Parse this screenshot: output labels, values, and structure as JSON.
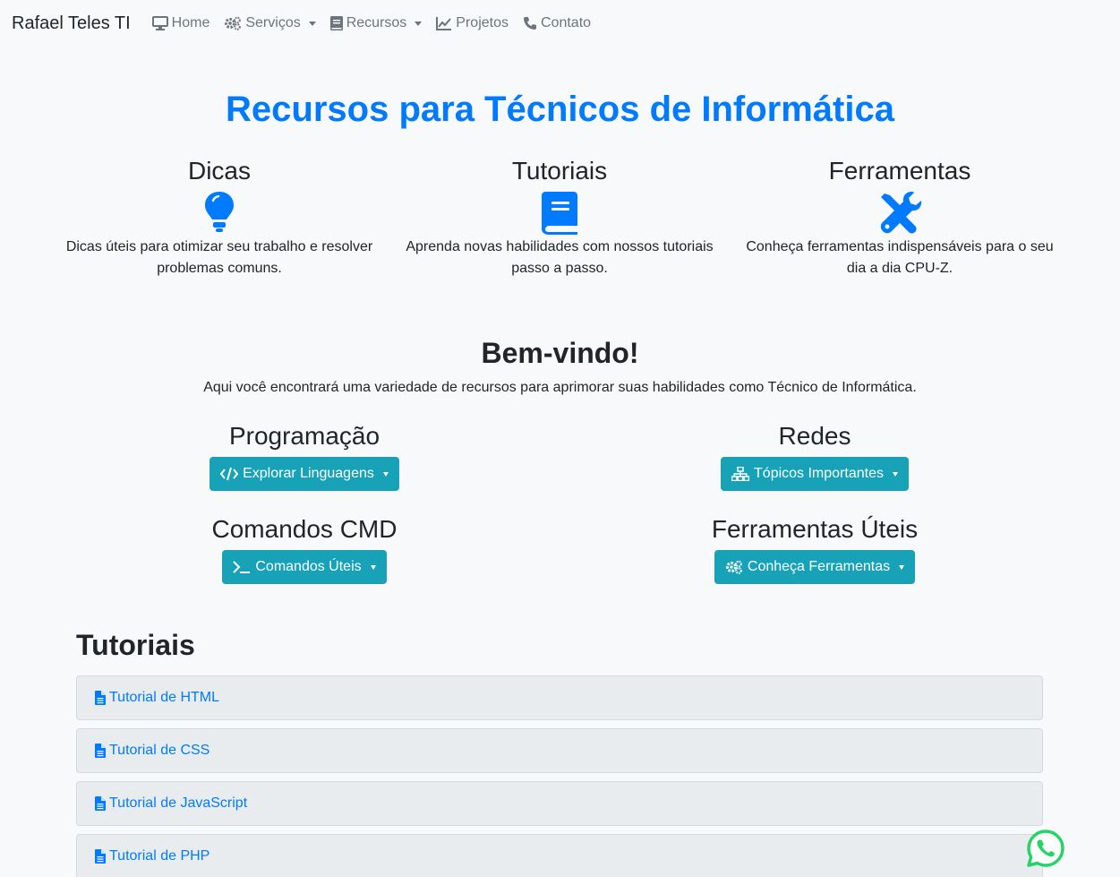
{
  "navbar": {
    "brand": "Rafael Teles TI",
    "items": [
      {
        "label": "Home",
        "icon": "desktop-icon",
        "dropdown": false
      },
      {
        "label": "Serviços",
        "icon": "cogs-icon",
        "dropdown": true
      },
      {
        "label": "Recursos",
        "icon": "book-icon",
        "dropdown": true
      },
      {
        "label": "Projetos",
        "icon": "line-chart-icon",
        "dropdown": false
      },
      {
        "label": "Contato",
        "icon": "phone-icon",
        "dropdown": false
      }
    ]
  },
  "hero": {
    "title": "Recursos para Técnicos de Informática",
    "features": [
      {
        "title": "Dicas",
        "icon": "lightbulb-icon",
        "text": "Dicas úteis para otimizar seu trabalho e resolver problemas comuns."
      },
      {
        "title": "Tutoriais",
        "icon": "book-icon",
        "text": "Aprenda novas habilidades com nossos tutoriais passo a passo."
      },
      {
        "title": "Ferramentas",
        "icon": "tools-icon",
        "text": "Conheça ferramentas indispensáveis para o seu dia a dia CPU-Z."
      }
    ]
  },
  "welcome": {
    "title": "Bem-vindo!",
    "text": "Aqui você encontrará uma variedade de recursos para aprimorar suas habilidades como Técnico de Informática."
  },
  "categories": [
    {
      "title": "Programação",
      "button": "Explorar Linguagens",
      "icon": "code-icon"
    },
    {
      "title": "Redes",
      "button": "Tópicos Importantes",
      "icon": "sitemap-icon"
    },
    {
      "title": "Comandos CMD",
      "button": "Comandos Úteis",
      "icon": "terminal-icon"
    },
    {
      "title": "Ferramentas Úteis",
      "button": "Conheça Ferramentas",
      "icon": "cogs-icon"
    }
  ],
  "tutorials": {
    "title": "Tutoriais",
    "items": [
      {
        "label": "Tutorial de HTML",
        "icon": "file-icon"
      },
      {
        "label": "Tutorial de CSS",
        "icon": "file-icon"
      },
      {
        "label": "Tutorial de JavaScript",
        "icon": "file-icon"
      },
      {
        "label": "Tutorial de PHP",
        "icon": "file-icon"
      }
    ]
  },
  "colors": {
    "primary": "#007bff",
    "info": "#17a2b8",
    "background": "#f8f9fa",
    "whatsapp": "#25d366"
  },
  "floating": {
    "icon": "whatsapp-icon"
  }
}
